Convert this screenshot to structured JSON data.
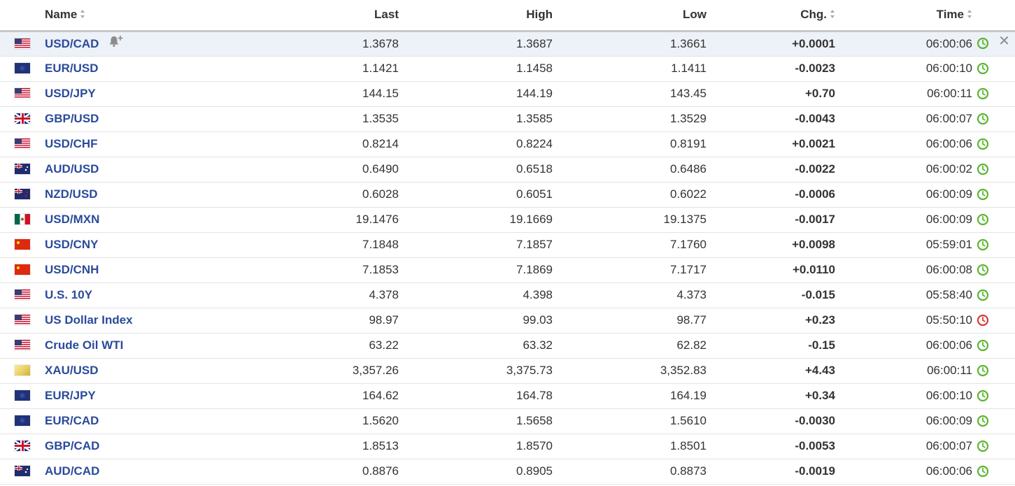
{
  "columns": {
    "name": "Name",
    "last": "Last",
    "high": "High",
    "low": "Low",
    "chg": "Chg.",
    "time": "Time"
  },
  "rows": [
    {
      "flag": "us",
      "name": "USD/CAD",
      "last": "1.3678",
      "high": "1.3687",
      "low": "1.3661",
      "chg": "+0.0001",
      "direction": "up",
      "time": "06:00:06",
      "status": "open",
      "alert": true,
      "close": true
    },
    {
      "flag": "eu",
      "name": "EUR/USD",
      "last": "1.1421",
      "high": "1.1458",
      "low": "1.1411",
      "chg": "-0.0023",
      "direction": "down",
      "time": "06:00:10",
      "status": "open"
    },
    {
      "flag": "us",
      "name": "USD/JPY",
      "last": "144.15",
      "high": "144.19",
      "low": "143.45",
      "chg": "+0.70",
      "direction": "up",
      "time": "06:00:11",
      "status": "open"
    },
    {
      "flag": "gb",
      "name": "GBP/USD",
      "last": "1.3535",
      "high": "1.3585",
      "low": "1.3529",
      "chg": "-0.0043",
      "direction": "down",
      "time": "06:00:07",
      "status": "open"
    },
    {
      "flag": "us",
      "name": "USD/CHF",
      "last": "0.8214",
      "high": "0.8224",
      "low": "0.8191",
      "chg": "+0.0021",
      "direction": "up",
      "time": "06:00:06",
      "status": "open"
    },
    {
      "flag": "au",
      "name": "AUD/USD",
      "last": "0.6490",
      "high": "0.6518",
      "low": "0.6486",
      "chg": "-0.0022",
      "direction": "down",
      "time": "06:00:02",
      "status": "open"
    },
    {
      "flag": "nz",
      "name": "NZD/USD",
      "last": "0.6028",
      "high": "0.6051",
      "low": "0.6022",
      "chg": "-0.0006",
      "direction": "down",
      "time": "06:00:09",
      "status": "open"
    },
    {
      "flag": "mx",
      "name": "USD/MXN",
      "last": "19.1476",
      "high": "19.1669",
      "low": "19.1375",
      "chg": "-0.0017",
      "direction": "down",
      "time": "06:00:09",
      "status": "open"
    },
    {
      "flag": "cn",
      "name": "USD/CNY",
      "last": "7.1848",
      "high": "7.1857",
      "low": "7.1760",
      "chg": "+0.0098",
      "direction": "up",
      "time": "05:59:01",
      "status": "open"
    },
    {
      "flag": "cn",
      "name": "USD/CNH",
      "last": "7.1853",
      "high": "7.1869",
      "low": "7.1717",
      "chg": "+0.0110",
      "direction": "up",
      "time": "06:00:08",
      "status": "open"
    },
    {
      "flag": "us",
      "name": "U.S. 10Y",
      "last": "4.378",
      "high": "4.398",
      "low": "4.373",
      "chg": "-0.015",
      "direction": "down",
      "time": "05:58:40",
      "status": "open"
    },
    {
      "flag": "us",
      "name": "US Dollar Index",
      "last": "98.97",
      "high": "99.03",
      "low": "98.77",
      "chg": "+0.23",
      "direction": "up",
      "time": "05:50:10",
      "status": "closed"
    },
    {
      "flag": "us",
      "name": "Crude Oil WTI",
      "last": "63.22",
      "high": "63.32",
      "low": "62.82",
      "chg": "-0.15",
      "direction": "down",
      "time": "06:00:06",
      "status": "open"
    },
    {
      "flag": "gold",
      "name": "XAU/USD",
      "last": "3,357.26",
      "high": "3,375.73",
      "low": "3,352.83",
      "chg": "+4.43",
      "direction": "up",
      "time": "06:00:11",
      "status": "open"
    },
    {
      "flag": "eu",
      "name": "EUR/JPY",
      "last": "164.62",
      "high": "164.78",
      "low": "164.19",
      "chg": "+0.34",
      "direction": "up",
      "time": "06:00:10",
      "status": "open"
    },
    {
      "flag": "eu",
      "name": "EUR/CAD",
      "last": "1.5620",
      "high": "1.5658",
      "low": "1.5610",
      "chg": "-0.0030",
      "direction": "down",
      "time": "06:00:09",
      "status": "open"
    },
    {
      "flag": "gb",
      "name": "GBP/CAD",
      "last": "1.8513",
      "high": "1.8570",
      "low": "1.8501",
      "chg": "-0.0053",
      "direction": "down",
      "time": "06:00:07",
      "status": "open"
    },
    {
      "flag": "au",
      "name": "AUD/CAD",
      "last": "0.8876",
      "high": "0.8905",
      "low": "0.8873",
      "chg": "-0.0019",
      "direction": "down",
      "time": "06:00:06",
      "status": "open"
    }
  ],
  "colors": {
    "name_link": "#2a4b9b",
    "positive": "#3b9a1e",
    "negative": "#d8232a",
    "clock_open": "#5cb531",
    "clock_closed": "#d63a3a",
    "hover_row": "#edf1f8"
  },
  "icons": {
    "alert": "bell-plus-icon",
    "clock": "clock-icon",
    "close": "close-icon",
    "sort": "sort-arrows-icon"
  },
  "close_symbol": "✕"
}
